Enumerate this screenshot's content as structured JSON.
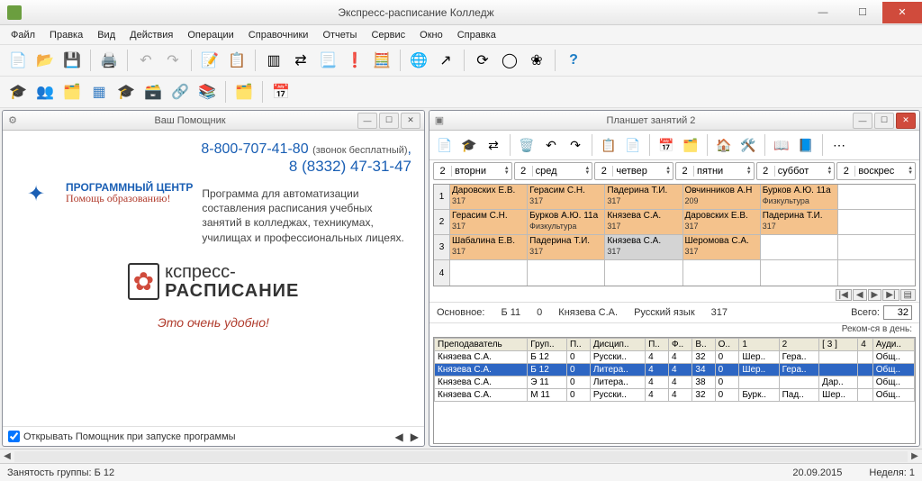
{
  "app": {
    "title": "Экспресс-расписание Колледж"
  },
  "menu": [
    "Файл",
    "Правка",
    "Вид",
    "Действия",
    "Операции",
    "Справочники",
    "Отчеты",
    "Сервис",
    "Окно",
    "Справка"
  ],
  "helper": {
    "title": "Ваш Помощник",
    "phone1": "8-800-707-41-80",
    "phone1_note": "(звонок бесплатный)",
    "phone2": "8 (8332) 47-31-47",
    "brand": "ПРОГРАММНЫЙ ЦЕНТР",
    "slogan": "Помощь образованию!",
    "desc": "Программа для автоматизации составления расписания учебных занятий в колледжах, техникумах, училищах и профессиональных лицеях.",
    "product_top": "кспресс-",
    "product_bottom": "РАСПИСАНИЕ",
    "tagline": "Это очень удобно!",
    "open_on_start": "Открывать Помощник при запуске программы"
  },
  "planner": {
    "title": "Планшет занятий 2",
    "days": [
      {
        "n": "2",
        "name": "вторни"
      },
      {
        "n": "2",
        "name": "сред"
      },
      {
        "n": "2",
        "name": "четвер"
      },
      {
        "n": "2",
        "name": "пятни"
      },
      {
        "n": "2",
        "name": "суббот"
      },
      {
        "n": "2",
        "name": "воскрес"
      }
    ],
    "rows": [
      {
        "n": "1",
        "cells": [
          {
            "t": "Даровских Е.В.",
            "r": "317",
            "c": "orange"
          },
          {
            "t": "Герасим С.Н.",
            "r": "317",
            "c": "orange"
          },
          {
            "t": "Падерина Т.И.",
            "r": "317",
            "c": "orange"
          },
          {
            "t": "Овчинников А.Н",
            "r": "209",
            "c": "orange"
          },
          {
            "t": "Бурков А.Ю. 11а",
            "r": "Физкультура",
            "c": "orange"
          },
          {
            "t": "",
            "r": "",
            "c": ""
          }
        ]
      },
      {
        "n": "2",
        "cells": [
          {
            "t": "Герасим С.Н.",
            "r": "317",
            "c": "orange"
          },
          {
            "t": "Бурков А.Ю. 11а",
            "r": "Физкультура",
            "c": "orange"
          },
          {
            "t": "Князева С.А.",
            "r": "317",
            "c": "orange"
          },
          {
            "t": "Даровских Е.В.",
            "r": "317",
            "c": "orange"
          },
          {
            "t": "Падерина Т.И.",
            "r": "317",
            "c": "orange"
          },
          {
            "t": "",
            "r": "",
            "c": ""
          }
        ]
      },
      {
        "n": "3",
        "cells": [
          {
            "t": "Шабалина Е.В.",
            "r": "317",
            "c": "orange"
          },
          {
            "t": "Падерина Т.И.",
            "r": "317",
            "c": "orange"
          },
          {
            "t": "Князева С.А.",
            "r": "317",
            "c": "grey"
          },
          {
            "t": "Шеромова С.А.",
            "r": "317",
            "c": "orange"
          },
          {
            "t": "",
            "r": "",
            "c": ""
          },
          {
            "t": "",
            "r": "",
            "c": ""
          }
        ]
      },
      {
        "n": "4",
        "cells": [
          {
            "t": "",
            "r": "",
            "c": ""
          },
          {
            "t": "",
            "r": "",
            "c": ""
          },
          {
            "t": "",
            "r": "",
            "c": ""
          },
          {
            "t": "",
            "r": "",
            "c": ""
          },
          {
            "t": "",
            "r": "",
            "c": ""
          },
          {
            "t": "",
            "r": "",
            "c": ""
          }
        ]
      }
    ],
    "info": {
      "main_label": "Основное:",
      "group": "Б 11",
      "zero": "0",
      "teacher": "Князева С.А.",
      "subject": "Русский язык",
      "room": "317",
      "total_label": "Всего:",
      "total": "32",
      "recom": "Реком-ся в день:"
    },
    "table": {
      "cols": [
        "Преподаватель",
        "Груп..",
        "П..",
        "Дисцип..",
        "П..",
        "Ф..",
        "В..",
        "О..",
        "1",
        "2",
        "[ 3 ]",
        "4",
        "Ауди.."
      ],
      "rows": [
        {
          "sel": false,
          "c": [
            "Князева С.А.",
            "Б 12",
            "0",
            "Русски..",
            "4",
            "4",
            "32",
            "0",
            "Шер..",
            "Гера..",
            "",
            "",
            "Общ.."
          ]
        },
        {
          "sel": true,
          "c": [
            "Князева С.А.",
            "Б 12",
            "0",
            "Литера..",
            "4",
            "4",
            "34",
            "0",
            "Шер..",
            "Гера..",
            "",
            "",
            "Общ.."
          ]
        },
        {
          "sel": false,
          "c": [
            "Князева С.А.",
            "Э 11",
            "0",
            "Литера..",
            "4",
            "4",
            "38",
            "0",
            "",
            "",
            "Дар..",
            "",
            "Общ.."
          ]
        },
        {
          "sel": false,
          "c": [
            "Князева С.А.",
            "М 11",
            "0",
            "Русски..",
            "4",
            "4",
            "32",
            "0",
            "Бурк..",
            "Пад..",
            "Шер..",
            "",
            "Общ.."
          ]
        }
      ]
    }
  },
  "status": {
    "left": "Занятость группы: Б 12",
    "date": "20.09.2015",
    "week": "Неделя: 1"
  }
}
